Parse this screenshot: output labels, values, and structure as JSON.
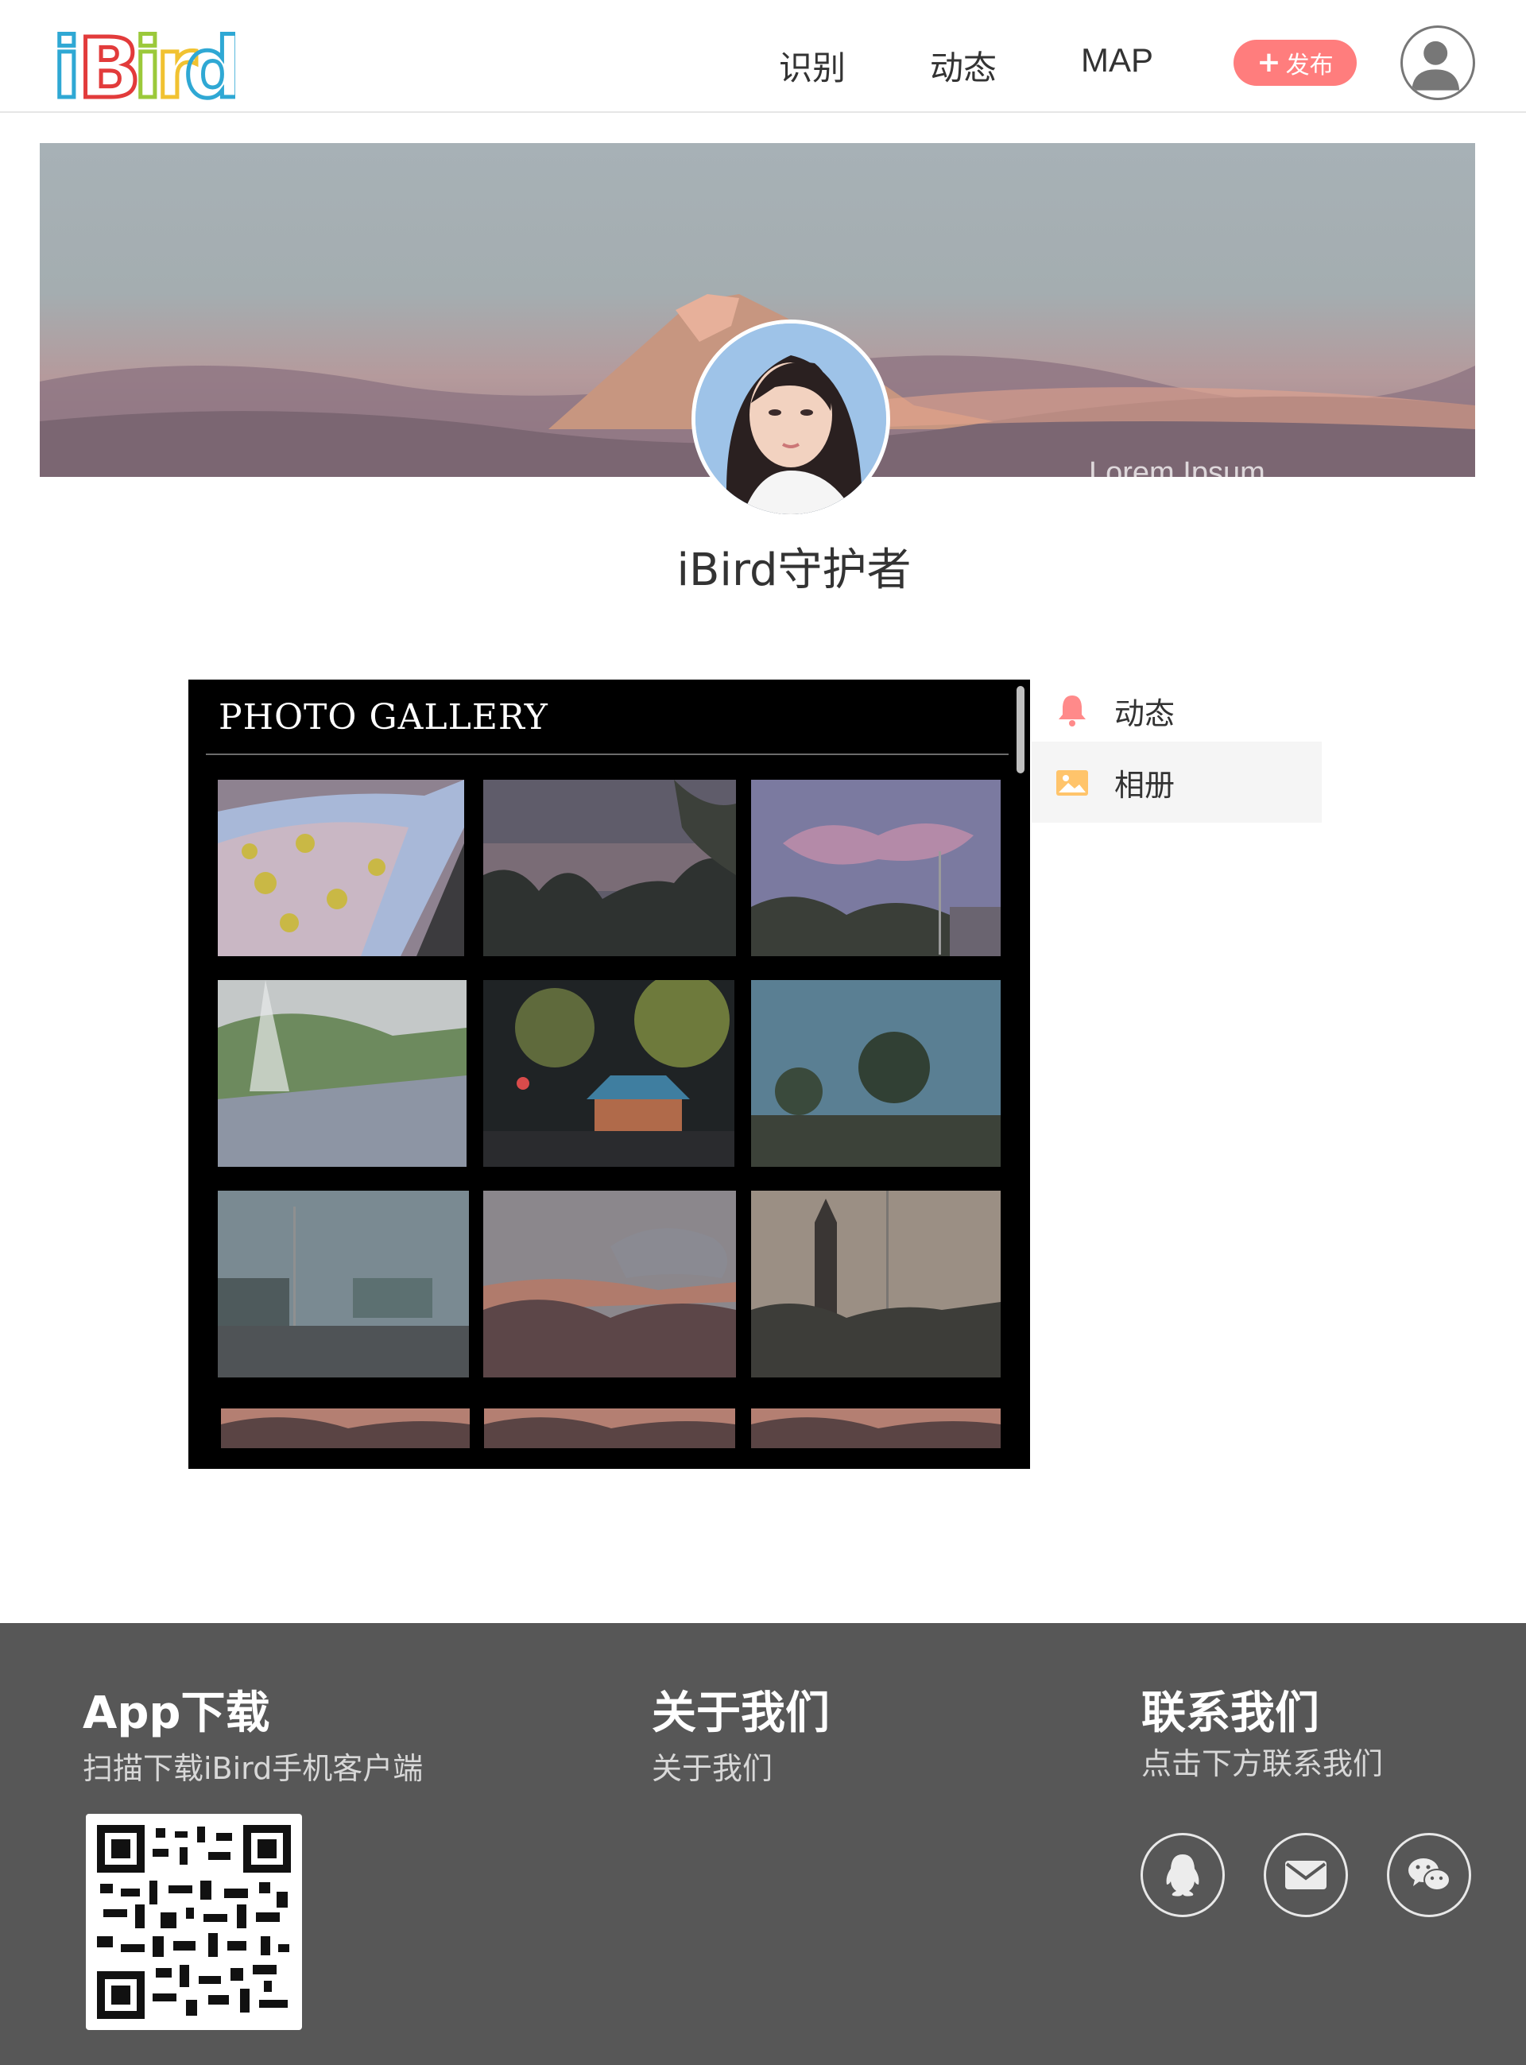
{
  "header": {
    "logo_text": "iBird",
    "nav": [
      {
        "label": "识别"
      },
      {
        "label": "动态"
      },
      {
        "label": "MAP"
      }
    ],
    "publish_label": "发布",
    "publish_icon": "plus-icon",
    "avatar_icon": "user-icon"
  },
  "banner": {
    "caption": "Lorem Ipsum"
  },
  "profile": {
    "name": "iBird守护者"
  },
  "gallery": {
    "title": "PHOTO GALLERY",
    "photo_count_visible": 12
  },
  "side_menu": [
    {
      "label": "动态",
      "icon": "bell-icon",
      "icon_color": "#ff8a8a"
    },
    {
      "label": "相册",
      "icon": "image-icon",
      "icon_color": "#ffc46b",
      "active": true
    }
  ],
  "footer": {
    "app": {
      "title": "App下载",
      "subtitle": "扫描下载iBird手机客户端"
    },
    "about": {
      "title": "关于我们",
      "link": "关于我们"
    },
    "contact": {
      "title": "联系我们",
      "subtitle": "点击下方联系我们"
    },
    "social_icons": [
      "qq-icon",
      "mail-icon",
      "wechat-icon"
    ]
  },
  "colors": {
    "publish_bg": "#ff7d7d",
    "footer_bg": "#575757",
    "gallery_bg": "#000000"
  }
}
